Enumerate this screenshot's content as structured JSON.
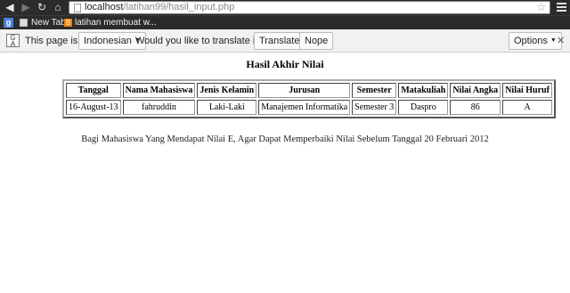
{
  "browser": {
    "url_host": "localhost",
    "url_path": "/latihan99/hasil_input.php",
    "bookmarks": [
      {
        "icon": "apps-icon",
        "label": ""
      },
      {
        "icon": "page-icon",
        "label": "New Tab"
      },
      {
        "icon": "blogger-icon",
        "label": "latihan membuat w..."
      }
    ]
  },
  "translate_bar": {
    "prefix": "This page is in",
    "language": "Indonesian",
    "question": "Would you like to translate it?",
    "translate_label": "Translate",
    "nope_label": "Nope",
    "options_label": "Options"
  },
  "page": {
    "title": "Hasil Akhir Nilai",
    "table": {
      "headers": [
        "Tanggal",
        "Nama Mahasiswa",
        "Jenis Kelamin",
        "Jurusan",
        "Semester",
        "Matakuliah",
        "Nilai Angka",
        "Nilai Huruf"
      ],
      "rows": [
        [
          "16-August-13",
          "fahruddin",
          "Laki-Laki",
          "Manajemen Informatika",
          "Semester 3",
          "Daspro",
          "86",
          "A"
        ]
      ]
    },
    "note": "Bagi Mahasiswa Yang Mendapat Nilai E, Agar Dapat Memperbaiki Nilai Sebelum Tanggal 20 Februari 2012"
  }
}
